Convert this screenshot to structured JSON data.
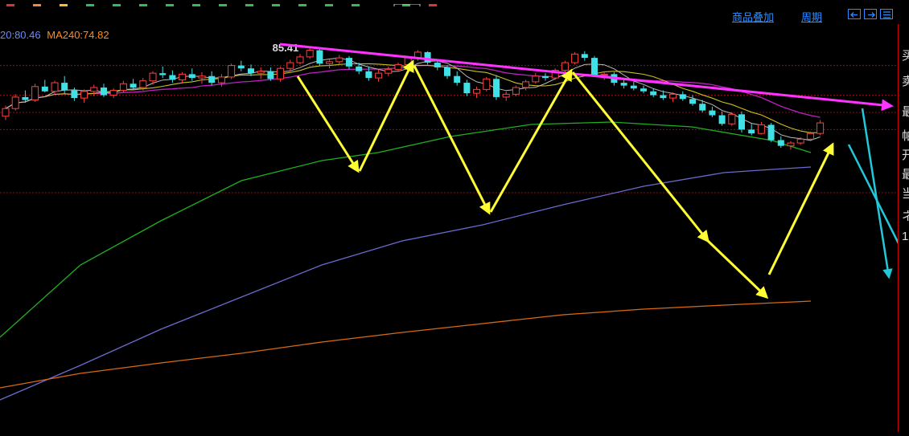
{
  "toolbar": {
    "overlay_label": "商品叠加",
    "period_label": "周期"
  },
  "legend": {
    "items": [
      {
        "text": "20:80.46",
        "color": "#6a88ff"
      },
      {
        "text": "MA240:74.82",
        "color": "#ff8c1a"
      }
    ]
  },
  "right_panel": {
    "labels": [
      "买",
      "卖",
      "最",
      "帕",
      "开",
      "最",
      "当",
      "ネ",
      "1"
    ]
  },
  "chart_data": {
    "type": "candlestick",
    "title": "",
    "xlabel": "",
    "ylabel": "",
    "y_range": [
      68,
      88
    ],
    "grid": "horizontal dotted red",
    "annotations": [
      {
        "type": "price_label",
        "text": "85.41",
        "value": 85.41
      }
    ],
    "ma_legend": [
      "20:80.46",
      "MA240:74.82"
    ],
    "ohlc": [
      [
        78.2,
        79.3,
        77.8,
        79.0
      ],
      [
        79.0,
        80.5,
        78.8,
        80.2
      ],
      [
        80.2,
        80.9,
        79.6,
        79.9
      ],
      [
        79.9,
        81.6,
        79.7,
        81.3
      ],
      [
        81.3,
        82.0,
        80.7,
        80.8
      ],
      [
        80.8,
        81.9,
        80.5,
        81.7
      ],
      [
        81.7,
        82.4,
        80.6,
        80.9
      ],
      [
        80.9,
        81.2,
        79.8,
        80.1
      ],
      [
        80.1,
        81.0,
        79.6,
        80.8
      ],
      [
        80.8,
        81.5,
        80.3,
        81.2
      ],
      [
        81.2,
        81.6,
        80.2,
        80.4
      ],
      [
        80.4,
        81.1,
        80.1,
        80.9
      ],
      [
        80.9,
        81.9,
        80.7,
        81.6
      ],
      [
        81.6,
        82.1,
        81.0,
        81.2
      ],
      [
        81.2,
        82.2,
        80.9,
        81.9
      ],
      [
        81.9,
        82.9,
        81.5,
        82.7
      ],
      [
        82.7,
        83.4,
        82.2,
        82.5
      ],
      [
        82.5,
        83.0,
        81.7,
        82.0
      ],
      [
        82.0,
        82.8,
        81.6,
        82.6
      ],
      [
        82.6,
        83.2,
        81.9,
        82.2
      ],
      [
        82.2,
        82.8,
        81.6,
        82.4
      ],
      [
        82.4,
        82.9,
        81.4,
        81.7
      ],
      [
        81.7,
        82.6,
        81.3,
        82.3
      ],
      [
        82.3,
        83.7,
        82.1,
        83.5
      ],
      [
        83.5,
        84.0,
        82.9,
        83.2
      ],
      [
        83.2,
        83.6,
        82.4,
        82.7
      ],
      [
        82.7,
        83.3,
        82.1,
        82.9
      ],
      [
        82.9,
        83.3,
        81.9,
        82.1
      ],
      [
        82.1,
        83.4,
        81.8,
        83.2
      ],
      [
        83.2,
        84.1,
        82.9,
        83.8
      ],
      [
        83.8,
        84.7,
        83.6,
        84.4
      ],
      [
        84.4,
        85.41,
        84.2,
        85.1
      ],
      [
        85.1,
        85.3,
        83.5,
        83.7
      ],
      [
        83.7,
        84.1,
        83.2,
        83.9
      ],
      [
        83.9,
        84.6,
        83.6,
        84.3
      ],
      [
        84.3,
        84.5,
        83.1,
        83.4
      ],
      [
        83.4,
        83.8,
        82.6,
        82.9
      ],
      [
        82.9,
        83.4,
        81.9,
        82.2
      ],
      [
        82.2,
        83.1,
        81.8,
        82.7
      ],
      [
        82.7,
        83.4,
        82.4,
        83.1
      ],
      [
        83.1,
        83.8,
        82.9,
        83.6
      ],
      [
        83.6,
        84.5,
        83.4,
        84.3
      ],
      [
        84.3,
        85.1,
        84.0,
        84.9
      ],
      [
        84.9,
        85.0,
        83.6,
        83.8
      ],
      [
        83.8,
        84.1,
        83.0,
        83.3
      ],
      [
        83.3,
        83.5,
        82.1,
        82.4
      ],
      [
        82.4,
        82.9,
        81.4,
        81.7
      ],
      [
        81.7,
        82.0,
        80.3,
        80.6
      ],
      [
        80.6,
        81.3,
        80.1,
        81.0
      ],
      [
        81.0,
        82.3,
        80.8,
        82.1
      ],
      [
        82.1,
        82.5,
        79.9,
        80.2
      ],
      [
        80.2,
        80.8,
        79.8,
        80.5
      ],
      [
        80.5,
        81.4,
        80.3,
        81.2
      ],
      [
        81.2,
        82.0,
        80.9,
        81.8
      ],
      [
        81.8,
        82.7,
        81.6,
        82.4
      ],
      [
        82.4,
        82.7,
        81.9,
        82.2
      ],
      [
        82.2,
        83.2,
        82.0,
        83.0
      ],
      [
        83.0,
        84.0,
        82.8,
        83.8
      ],
      [
        83.8,
        84.9,
        83.6,
        84.7
      ],
      [
        84.7,
        85.0,
        84.0,
        84.3
      ],
      [
        84.3,
        84.5,
        82.3,
        82.5
      ],
      [
        82.5,
        82.9,
        82.0,
        82.6
      ],
      [
        82.6,
        82.8,
        81.4,
        81.7
      ],
      [
        81.7,
        82.1,
        81.1,
        81.4
      ],
      [
        81.4,
        81.8,
        80.9,
        81.1
      ],
      [
        81.1,
        81.4,
        80.6,
        80.8
      ],
      [
        80.8,
        81.1,
        80.2,
        80.4
      ],
      [
        80.4,
        80.9,
        79.9,
        80.1
      ],
      [
        80.1,
        80.7,
        79.7,
        80.5
      ],
      [
        80.5,
        80.8,
        79.8,
        80.0
      ],
      [
        80.0,
        80.4,
        79.3,
        79.5
      ],
      [
        79.5,
        79.9,
        78.6,
        78.8
      ],
      [
        78.8,
        79.2,
        78.1,
        78.3
      ],
      [
        78.3,
        78.7,
        77.2,
        77.4
      ],
      [
        77.4,
        78.6,
        77.2,
        78.4
      ],
      [
        78.4,
        78.7,
        76.5,
        76.8
      ],
      [
        76.8,
        77.4,
        76.2,
        76.4
      ],
      [
        76.4,
        77.6,
        76.3,
        77.3
      ],
      [
        77.3,
        77.5,
        75.5,
        75.7
      ],
      [
        75.7,
        76.1,
        74.9,
        75.1
      ],
      [
        75.1,
        75.6,
        74.7,
        75.4
      ],
      [
        75.4,
        76.0,
        75.2,
        75.8
      ],
      [
        75.8,
        76.6,
        75.6,
        76.4
      ],
      [
        76.4,
        77.8,
        76.2,
        77.5
      ]
    ]
  }
}
